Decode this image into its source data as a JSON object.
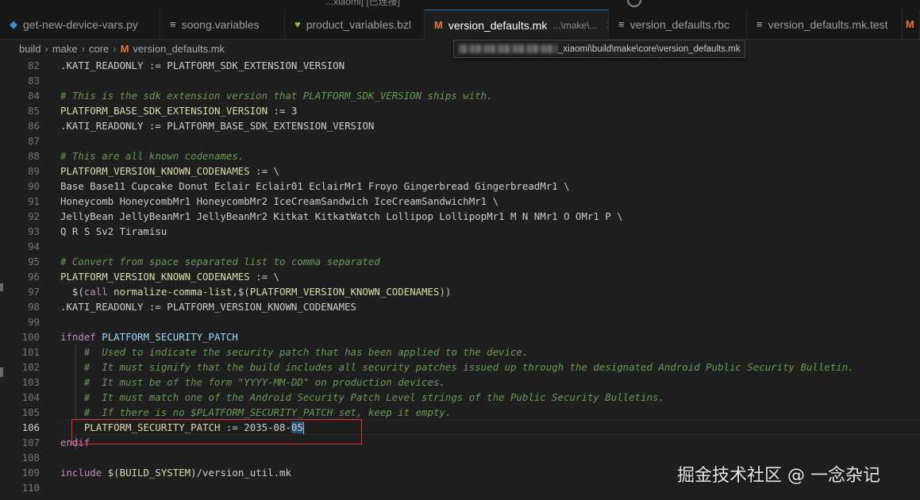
{
  "window": {
    "title_fragment": "...xiaomi] [已连接]"
  },
  "tabs": [
    {
      "icon": "python-icon",
      "label": "get-new-device-vars.py",
      "active": false
    },
    {
      "icon": "lines-icon",
      "label": "soong.variables",
      "active": false
    },
    {
      "icon": "heart-icon",
      "label": "product_variables.bzl",
      "active": false
    },
    {
      "icon": "makefile-icon",
      "label": "version_defaults.mk",
      "desc": "...\\make\\...",
      "active": true
    },
    {
      "icon": "lines-icon",
      "label": "version_defaults.rbc",
      "active": false
    },
    {
      "icon": "lines-icon",
      "label": "version_defaults.mk.test",
      "active": false
    }
  ],
  "breadcrumb": {
    "p1": "build",
    "p2": "make",
    "p3": "core",
    "file": "version_defaults.mk",
    "sep": "›"
  },
  "tooltip": {
    "path_visible": "_xiaomi\\build\\make\\core\\version_defaults.mk"
  },
  "editor": {
    "lines": [
      {
        "n": "82",
        "parts": [
          [
            "plain",
            ".KATI_READONLY := PLATFORM_SDK_EXTENSION_VERSION"
          ]
        ]
      },
      {
        "n": "83",
        "parts": []
      },
      {
        "n": "84",
        "parts": [
          [
            "cm",
            "# This is the sdk extension version that PLATFORM_SDK_VERSION ships with."
          ]
        ]
      },
      {
        "n": "85",
        "parts": [
          [
            "var2",
            "PLATFORM_BASE_SDK_EXTENSION_VERSION"
          ],
          [
            "plain",
            " := 3"
          ]
        ]
      },
      {
        "n": "86",
        "parts": [
          [
            "plain",
            ".KATI_READONLY := PLATFORM_BASE_SDK_EXTENSION_VERSION"
          ]
        ]
      },
      {
        "n": "87",
        "parts": []
      },
      {
        "n": "88",
        "parts": [
          [
            "cm",
            "# This are all known codenames."
          ]
        ]
      },
      {
        "n": "89",
        "parts": [
          [
            "var2",
            "PLATFORM_VERSION_KNOWN_CODENAMES"
          ],
          [
            "plain",
            " := \\"
          ]
        ]
      },
      {
        "n": "90",
        "parts": [
          [
            "plain",
            "Base Base11 Cupcake Donut Eclair Eclair01 EclairMr1 Froyo Gingerbread GingerbreadMr1 \\"
          ]
        ]
      },
      {
        "n": "91",
        "parts": [
          [
            "plain",
            "Honeycomb HoneycombMr1 HoneycombMr2 IceCreamSandwich IceCreamSandwichMr1 \\"
          ]
        ]
      },
      {
        "n": "92",
        "parts": [
          [
            "plain",
            "JellyBean JellyBeanMr1 JellyBeanMr2 Kitkat KitkatWatch Lollipop LollipopMr1 M N NMr1 O OMr1 P \\"
          ]
        ]
      },
      {
        "n": "93",
        "parts": [
          [
            "plain",
            "Q R S Sv2 Tiramisu"
          ]
        ]
      },
      {
        "n": "94",
        "parts": []
      },
      {
        "n": "95",
        "parts": [
          [
            "cm",
            "# Convert from space separated list to comma separated"
          ]
        ]
      },
      {
        "n": "96",
        "parts": [
          [
            "var2",
            "PLATFORM_VERSION_KNOWN_CODENAMES"
          ],
          [
            "plain",
            " := \\"
          ]
        ]
      },
      {
        "n": "97",
        "parts": [
          [
            "plain",
            "  $("
          ],
          [
            "kw",
            "call"
          ],
          [
            "plain",
            " "
          ],
          [
            "var2",
            "normalize-comma-list"
          ],
          [
            "plain",
            ",$("
          ],
          [
            "var2",
            "PLATFORM_VERSION_KNOWN_CODENAMES"
          ],
          [
            "plain",
            "))"
          ]
        ]
      },
      {
        "n": "98",
        "parts": [
          [
            "plain",
            ".KATI_READONLY := PLATFORM_VERSION_KNOWN_CODENAMES"
          ]
        ]
      },
      {
        "n": "99",
        "parts": []
      },
      {
        "n": "100",
        "parts": [
          [
            "kw",
            "ifndef"
          ],
          [
            "plain",
            " "
          ],
          [
            "var3",
            "PLATFORM_SECURITY_PATCH"
          ]
        ]
      },
      {
        "n": "101",
        "parts": [
          [
            "cm",
            "    #  Used to indicate the security patch that has been applied to the device."
          ]
        ]
      },
      {
        "n": "102",
        "parts": [
          [
            "cm",
            "    #  It must signify that the build includes all security patches issued up through the designated Android Public Security Bulletin."
          ]
        ]
      },
      {
        "n": "103",
        "parts": [
          [
            "cm",
            "    #  It must be of the form \"YYYY-MM-DD\" on production devices."
          ]
        ]
      },
      {
        "n": "104",
        "parts": [
          [
            "cm",
            "    #  It must match one of the Android Security Patch Level strings of the Public Security Bulletins."
          ]
        ]
      },
      {
        "n": "105",
        "parts": [
          [
            "cm",
            "    #  If there is no $PLATFORM_SECURITY_PATCH set, keep it empty."
          ]
        ]
      },
      {
        "n": "106",
        "parts": [
          [
            "plain",
            "    "
          ],
          [
            "var2",
            "PLATFORM_SECURITY_PATCH"
          ],
          [
            "plain",
            " := 2035-08-"
          ],
          [
            "sel",
            "05"
          ]
        ],
        "current": true
      },
      {
        "n": "107",
        "parts": [
          [
            "kw",
            "endif"
          ]
        ]
      },
      {
        "n": "108",
        "parts": []
      },
      {
        "n": "109",
        "parts": [
          [
            "kw",
            "include"
          ],
          [
            "plain",
            " $("
          ],
          [
            "var2",
            "BUILD_SYSTEM"
          ],
          [
            "plain",
            ")/version_util.mk"
          ]
        ]
      },
      {
        "n": "110",
        "parts": []
      }
    ]
  },
  "watermark": "掘金技术社区 @ 一念杂记"
}
